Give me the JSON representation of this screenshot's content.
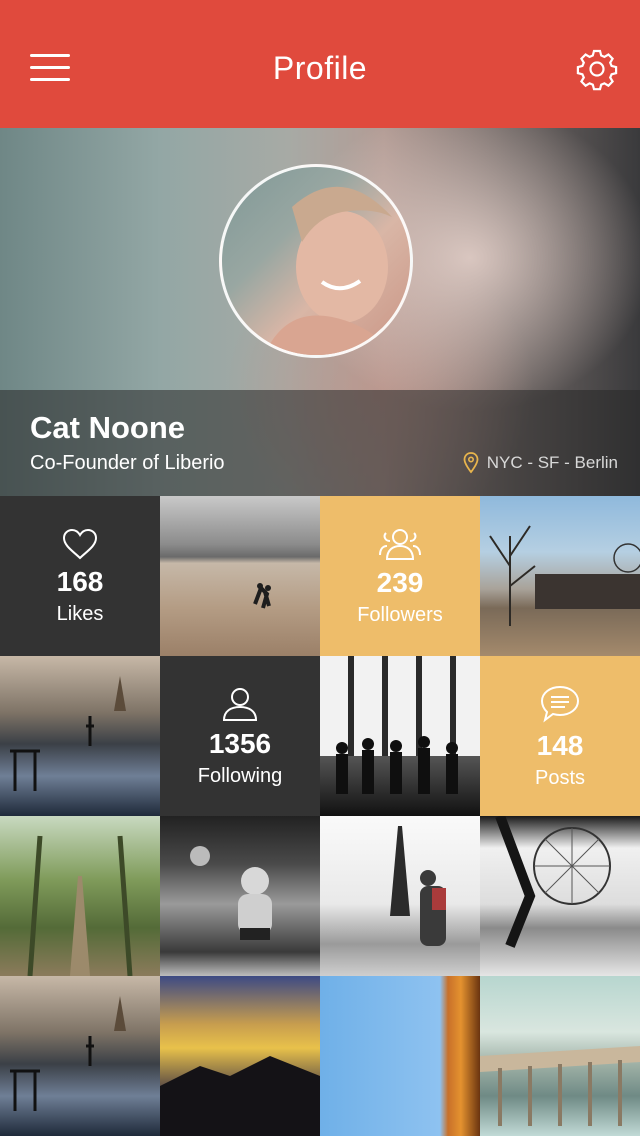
{
  "header": {
    "title": "Profile"
  },
  "profile": {
    "name": "Cat Noone",
    "role": "Co-Founder of Liberio",
    "location": "NYC - SF - Berlin"
  },
  "stats": {
    "likes": {
      "count": "168",
      "label": "Likes"
    },
    "followers": {
      "count": "239",
      "label": "Followers"
    },
    "following": {
      "count": "1356",
      "label": "Following"
    },
    "posts": {
      "count": "148",
      "label": "Posts"
    }
  },
  "colors": {
    "header": "#e04a3d",
    "stat_dark": "#333333",
    "stat_orange": "#eebd6a",
    "location_pin": "#e8b54d"
  },
  "icons": {
    "menu": "hamburger-icon",
    "settings": "gear-icon",
    "location": "map-pin-icon",
    "likes": "heart-icon",
    "followers": "users-icon",
    "following": "user-icon",
    "posts": "chat-bubble-icon"
  }
}
